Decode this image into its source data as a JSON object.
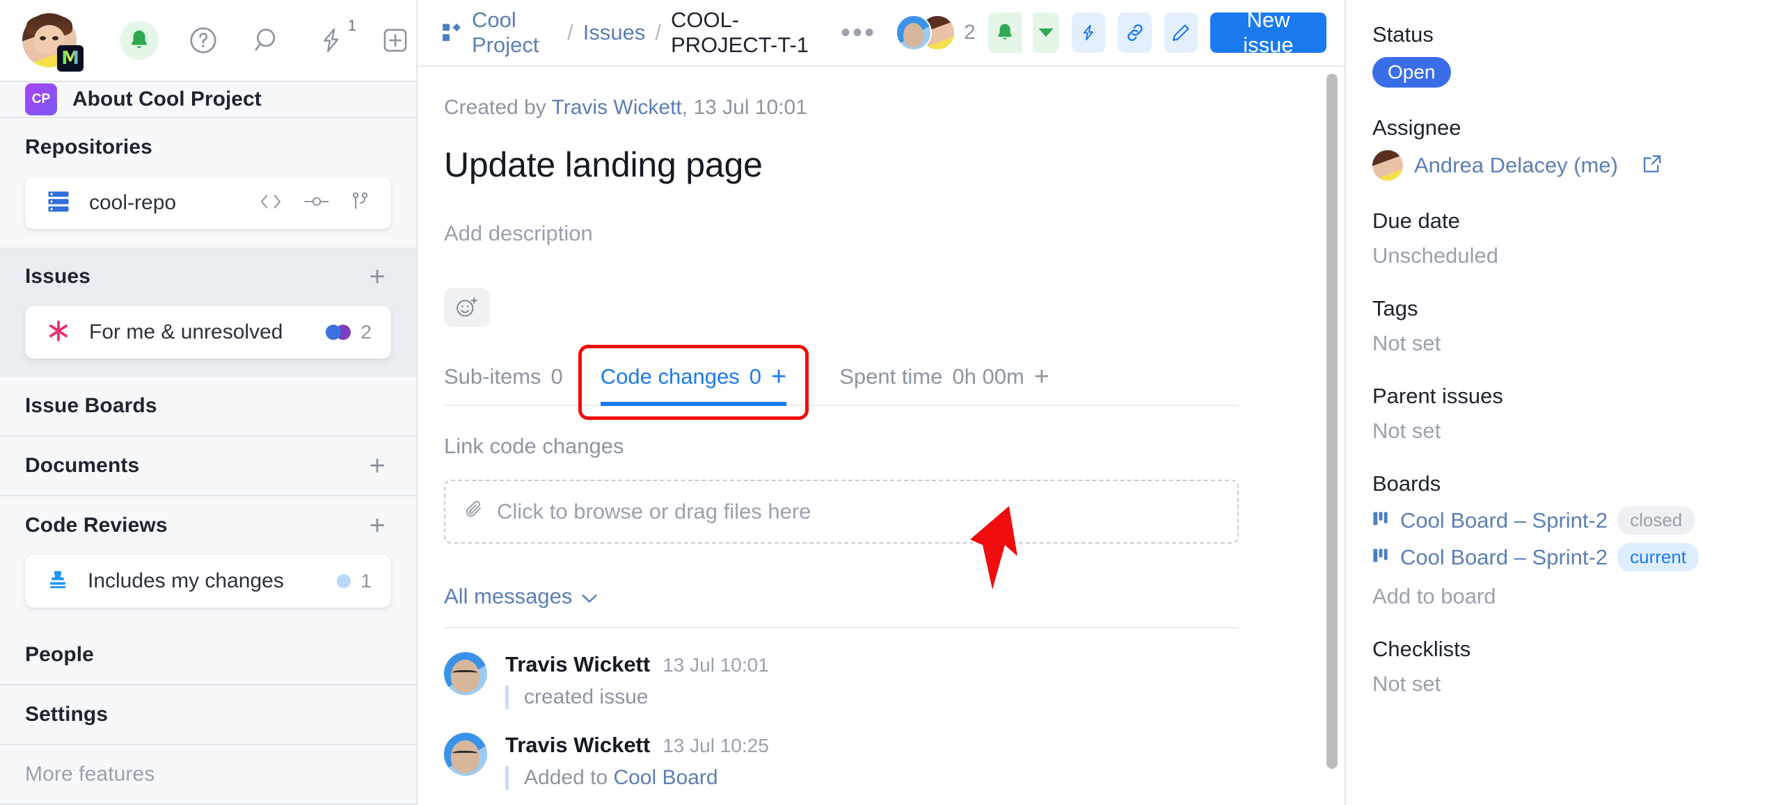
{
  "app": {
    "user_initials_badge": "M",
    "project_badge": "CP"
  },
  "sidebar": {
    "toolbar": {
      "bell_icon": "bell-icon",
      "help_icon": "question-circle-icon",
      "search_icon": "search-icon",
      "lightning_icon": "lightning-icon",
      "lightning_count": "1",
      "add_icon": "plus-square-icon"
    },
    "about": {
      "label": "About Cool Project"
    },
    "sections": [
      {
        "title": "Repositories",
        "has_plus": false
      },
      {
        "title": "Issues",
        "has_plus": true
      },
      {
        "title": "Issue Boards",
        "has_plus": false
      },
      {
        "title": "Documents",
        "has_plus": true
      },
      {
        "title": "Code Reviews",
        "has_plus": true
      },
      {
        "title": "People",
        "has_plus": false
      },
      {
        "title": "Settings",
        "has_plus": false
      },
      {
        "title": "More features",
        "has_plus": false
      }
    ],
    "repo_item": {
      "label": "cool-repo"
    },
    "issue_item": {
      "label": "For me & unresolved",
      "count": "2"
    },
    "review_item": {
      "label": "Includes my changes",
      "count": "1"
    }
  },
  "topbar": {
    "breadcrumb": {
      "project": "Cool Project",
      "sep1": "/",
      "section": "Issues",
      "sep2": "/",
      "current": "COOL-PROJECT-T-1"
    },
    "more_dots": "•••",
    "watchers_count": "2",
    "new_issue_label": "New issue",
    "icons": {
      "bell": "bell-icon",
      "chevron": "chevron-down-icon",
      "lightning": "lightning-icon",
      "link": "link-icon",
      "edit": "pencil-icon"
    }
  },
  "main": {
    "created_prefix": "Created by ",
    "created_author": "Travis Wickett",
    "created_suffix": ", 13 Jul 10:01",
    "title": "Update landing page",
    "add_description": "Add description",
    "reaction_icon": "add-reaction-icon",
    "tabs": [
      {
        "label": "Sub-items",
        "count": "0",
        "plus": false,
        "active": false
      },
      {
        "label": "Code changes",
        "count": "0",
        "plus": true,
        "active": true
      },
      {
        "label": "Spent time",
        "count": "0h 00m",
        "plus": true,
        "active": false
      }
    ],
    "link_code_changes": "Link code changes",
    "dropzone": {
      "icon": "paperclip-icon",
      "label": "Click to browse or drag files here"
    },
    "all_messages": "All messages",
    "messages": [
      {
        "author": "Travis Wickett",
        "time": "13 Jul 10:01",
        "text": "created issue",
        "link": ""
      },
      {
        "author": "Travis Wickett",
        "time": "13 Jul 10:25",
        "text": "Added to ",
        "link": "Cool Board"
      }
    ]
  },
  "rightpanel": {
    "status_label": "Status",
    "status_value": "Open",
    "assignee_label": "Assignee",
    "assignee_value": "Andrea Delacey (me)",
    "assignee_open_icon": "external-link-icon",
    "due_date_label": "Due date",
    "due_date_value": "Unscheduled",
    "tags_label": "Tags",
    "tags_value": "Not set",
    "parent_label": "Parent issues",
    "parent_value": "Not set",
    "boards_label": "Boards",
    "boards": [
      {
        "name": "Cool Board – Sprint-2",
        "badge": "closed"
      },
      {
        "name": "Cool Board – Sprint-2",
        "badge": "current"
      }
    ],
    "add_to_board": "Add to board",
    "checklists_label": "Checklists",
    "checklists_value": "Not set"
  },
  "colors": {
    "accent_blue": "#1a7aee",
    "status_blue": "#3a6ee8",
    "link_blue": "#5b7fb5",
    "highlight_red": "#f00c0c",
    "green": "#2fa84f"
  }
}
